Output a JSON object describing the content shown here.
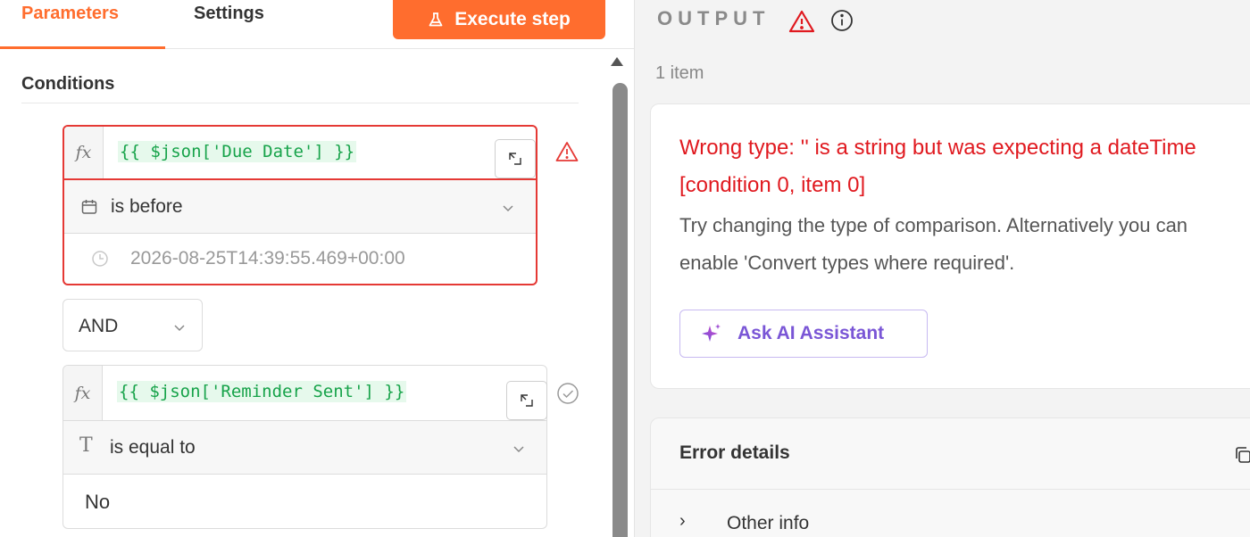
{
  "tabs": {
    "parameters": "Parameters",
    "settings": "Settings"
  },
  "execute_button": "Execute step",
  "conditions": {
    "title": "Conditions",
    "items": [
      {
        "expression": "{{ $json['Due Date'] }}",
        "operator": "is before",
        "value": "2026-08-25T14:39:55.469+00:00",
        "status": "error"
      },
      {
        "expression": "{{ $json['Reminder Sent'] }}",
        "operator": "is equal to",
        "value": "No",
        "status": "ok"
      }
    ],
    "combinator": "AND"
  },
  "output": {
    "title": "OUTPUT",
    "items_count": "1 item",
    "error_title": "Wrong type: '' is a string but was expecting a dateTime [condition 0, item 0]",
    "error_desc": "Try changing the type of comparison. Alternatively you can enable 'Convert types where required'.",
    "ai_button": "Ask AI Assistant",
    "details_title": "Error details",
    "other_info": "Other info"
  },
  "colors": {
    "accent": "#ff6d2e",
    "error": "#e0191f",
    "code": "#17a34a",
    "ai": "#7a56d6"
  }
}
